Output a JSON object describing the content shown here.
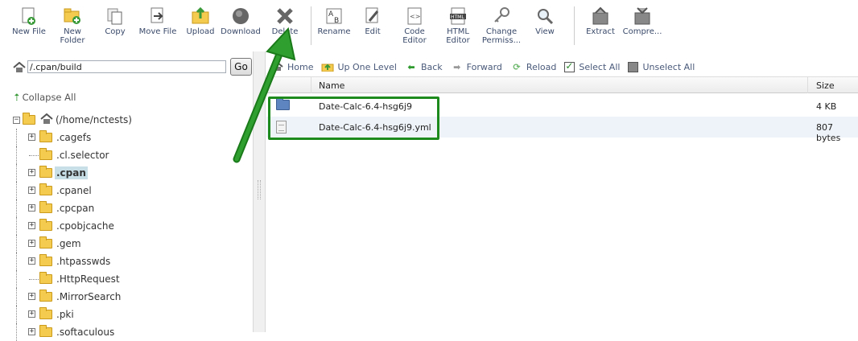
{
  "toolbar": {
    "new_file": "New File",
    "new_folder": "New\nFolder",
    "copy": "Copy",
    "move_file": "Move File",
    "upload": "Upload",
    "download": "Download",
    "delete": "Delete",
    "rename": "Rename",
    "edit": "Edit",
    "code_editor": "Code\nEditor",
    "html_editor": "HTML\nEditor",
    "change_permissions": "Change\nPermiss...",
    "view": "View",
    "extract": "Extract",
    "compress": "Compre..."
  },
  "path": {
    "value": "/.cpan/build",
    "go": "Go"
  },
  "tree": {
    "collapse_all": "Collapse All",
    "root": "(/home/nctests)",
    "items": [
      {
        "name": ".cagefs",
        "expandable": true
      },
      {
        "name": ".cl.selector",
        "expandable": false
      },
      {
        "name": ".cpan",
        "expandable": true,
        "selected": true
      },
      {
        "name": ".cpanel",
        "expandable": true
      },
      {
        "name": ".cpcpan",
        "expandable": true
      },
      {
        "name": ".cpobjcache",
        "expandable": true
      },
      {
        "name": ".gem",
        "expandable": true
      },
      {
        "name": ".htpasswds",
        "expandable": true
      },
      {
        "name": ".HttpRequest",
        "expandable": false
      },
      {
        "name": ".MirrorSearch",
        "expandable": true
      },
      {
        "name": ".pki",
        "expandable": true
      },
      {
        "name": ".softaculous",
        "expandable": true
      }
    ]
  },
  "navbar": {
    "home": "Home",
    "up_one_level": "Up One Level",
    "back": "Back",
    "forward": "Forward",
    "reload": "Reload",
    "select_all": "Select All",
    "unselect_all": "Unselect All"
  },
  "table": {
    "col_name": "Name",
    "col_size": "Size",
    "rows": [
      {
        "type": "folder",
        "name": "Date-Calc-6.4-hsg6j9",
        "size": "4 KB"
      },
      {
        "type": "file",
        "name": "Date-Calc-6.4-hsg6j9.yml",
        "size": "807 bytes"
      }
    ]
  },
  "colors": {
    "annotation": "#1d8a1d",
    "folder": "#f4cb4f",
    "selected_bg": "#c8dfe8"
  }
}
